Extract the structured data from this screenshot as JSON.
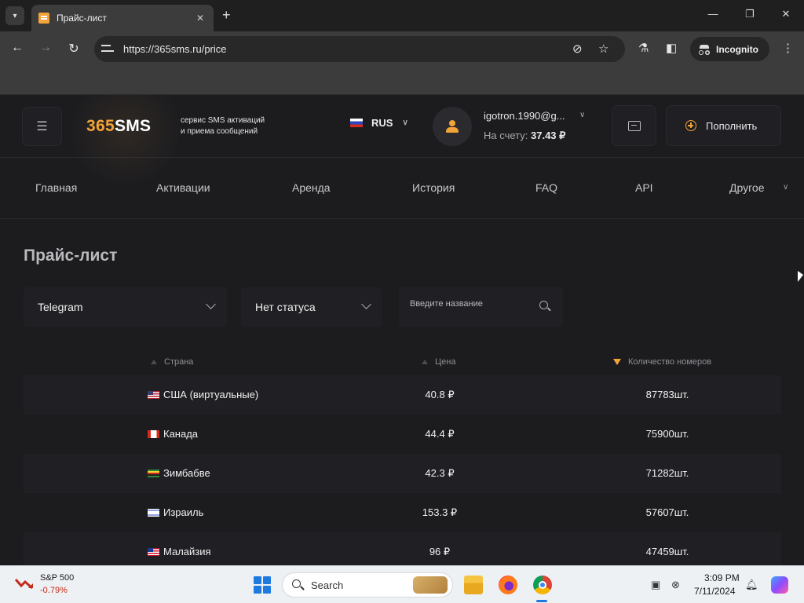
{
  "browser": {
    "tab_title": "Прайс-лист",
    "url": "https://365sms.ru/price",
    "incognito_label": "Incognito",
    "icons": [
      "tab-search-icon",
      "favicon",
      "close-icon",
      "plus-icon",
      "minimize-icon",
      "restore-icon",
      "window-close-icon",
      "back-icon",
      "forward-icon",
      "reload-icon",
      "site-settings-icon",
      "eye-off-icon",
      "star-icon",
      "labs-icon",
      "side-panel-icon",
      "incognito-icon",
      "more-icon"
    ]
  },
  "site": {
    "logo_num": "365",
    "logo_sms": "SMS",
    "tagline_line1": "сервис SMS активаций",
    "tagline_line2": "и приема сообщений",
    "lang": "RUS",
    "user_email": "igotron.1990@g...",
    "balance_label": "На счету:",
    "balance_value": "37.43 ₽",
    "topup_label": "Пополнить",
    "accent_color": "#f2a33a"
  },
  "menu": {
    "items": [
      "Главная",
      "Активации",
      "Аренда",
      "История",
      "FAQ",
      "API",
      "Другое"
    ]
  },
  "price": {
    "title": "Прайс-лист",
    "service_select": "Telegram",
    "status_select": "Нет статуса",
    "search_placeholder": "Введите название",
    "columns": [
      "Страна",
      "Цена",
      "Количество номеров"
    ],
    "rows": [
      {
        "country": "США (виртуальные)",
        "flag": "us",
        "price": "40.8 ₽",
        "qty": "87783шт."
      },
      {
        "country": "Канада",
        "flag": "ca",
        "price": "44.4 ₽",
        "qty": "75900шт."
      },
      {
        "country": "Зимбабве",
        "flag": "zw",
        "price": "42.3 ₽",
        "qty": "71282шт."
      },
      {
        "country": "Израиль",
        "flag": "il",
        "price": "153.3 ₽",
        "qty": "57607шт."
      },
      {
        "country": "Малайзия",
        "flag": "my",
        "price": "96 ₽",
        "qty": "47459шт."
      }
    ]
  },
  "taskbar": {
    "stock_name": "S&P 500",
    "stock_change": "-0.79%",
    "search_label": "Search",
    "time": "3:09 PM",
    "date": "7/11/2024"
  }
}
